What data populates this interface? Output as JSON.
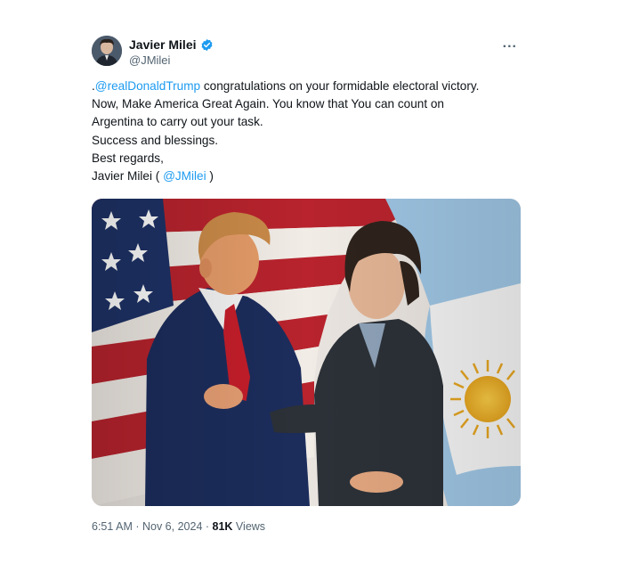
{
  "author": {
    "name": "Javier Milei",
    "handle": "@JMilei",
    "verified_color": "#1d9bf0"
  },
  "more_icon": "...",
  "tweet": {
    "line1_prefix": ".",
    "line1_mention": "@realDonaldTrump",
    "line1_rest": " congratulations on your formidable electoral victory.",
    "line2": "Now, Make America Great Again. You know that You can count on",
    "line3": "Argentina to carry out your task.",
    "line4": "Success and blessings.",
    "line5": "Best regards,",
    "line6_prefix": "Javier Milei ( ",
    "line6_mention": "@JMilei",
    "line6_suffix": " )"
  },
  "meta": {
    "time": "6:51 AM",
    "separator": " · ",
    "date": "Nov 6, 2024",
    "views_count": "81K",
    "views_label": " Views"
  },
  "colors": {
    "link": "#1d9bf0",
    "secondary_text": "#536471",
    "primary_text": "#0f1419"
  },
  "icons": {
    "verified": "verified-badge-icon",
    "more": "more-options-icon"
  }
}
